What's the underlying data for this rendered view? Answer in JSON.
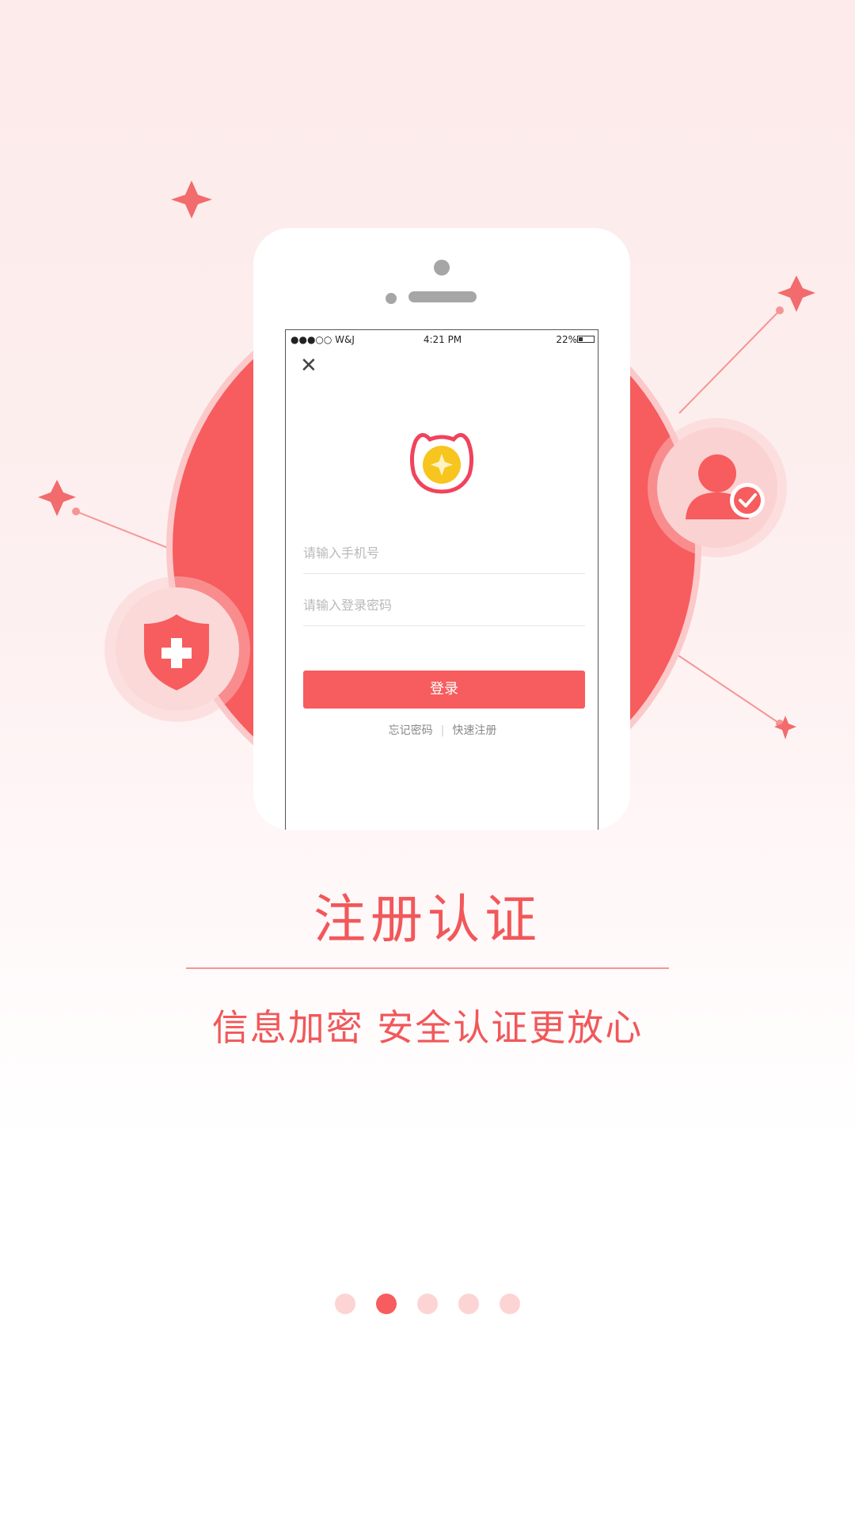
{
  "status_bar": {
    "carrier": "●●●○○ W&J",
    "time": "4:21 PM",
    "battery": "22%"
  },
  "login_screen": {
    "phone_placeholder": "请输入手机号",
    "password_placeholder": "请输入登录密码",
    "login_label": "登录",
    "forgot_password": "忘记密码",
    "separator": "|",
    "quick_register": "快速注册"
  },
  "slide": {
    "title": "注册认证",
    "subtitle": "信息加密 安全认证更放心",
    "page_count": 5,
    "active_page_index": 1
  },
  "icons": [
    "close-icon",
    "app-logo-icon",
    "user-verified-icon",
    "shield-plus-icon",
    "sparkle-icon"
  ],
  "colors": {
    "accent": "#f75c5e",
    "accent_light": "#fbc9c9",
    "text_accent": "#f1585a",
    "dot_inactive": "#fcd4d4"
  }
}
